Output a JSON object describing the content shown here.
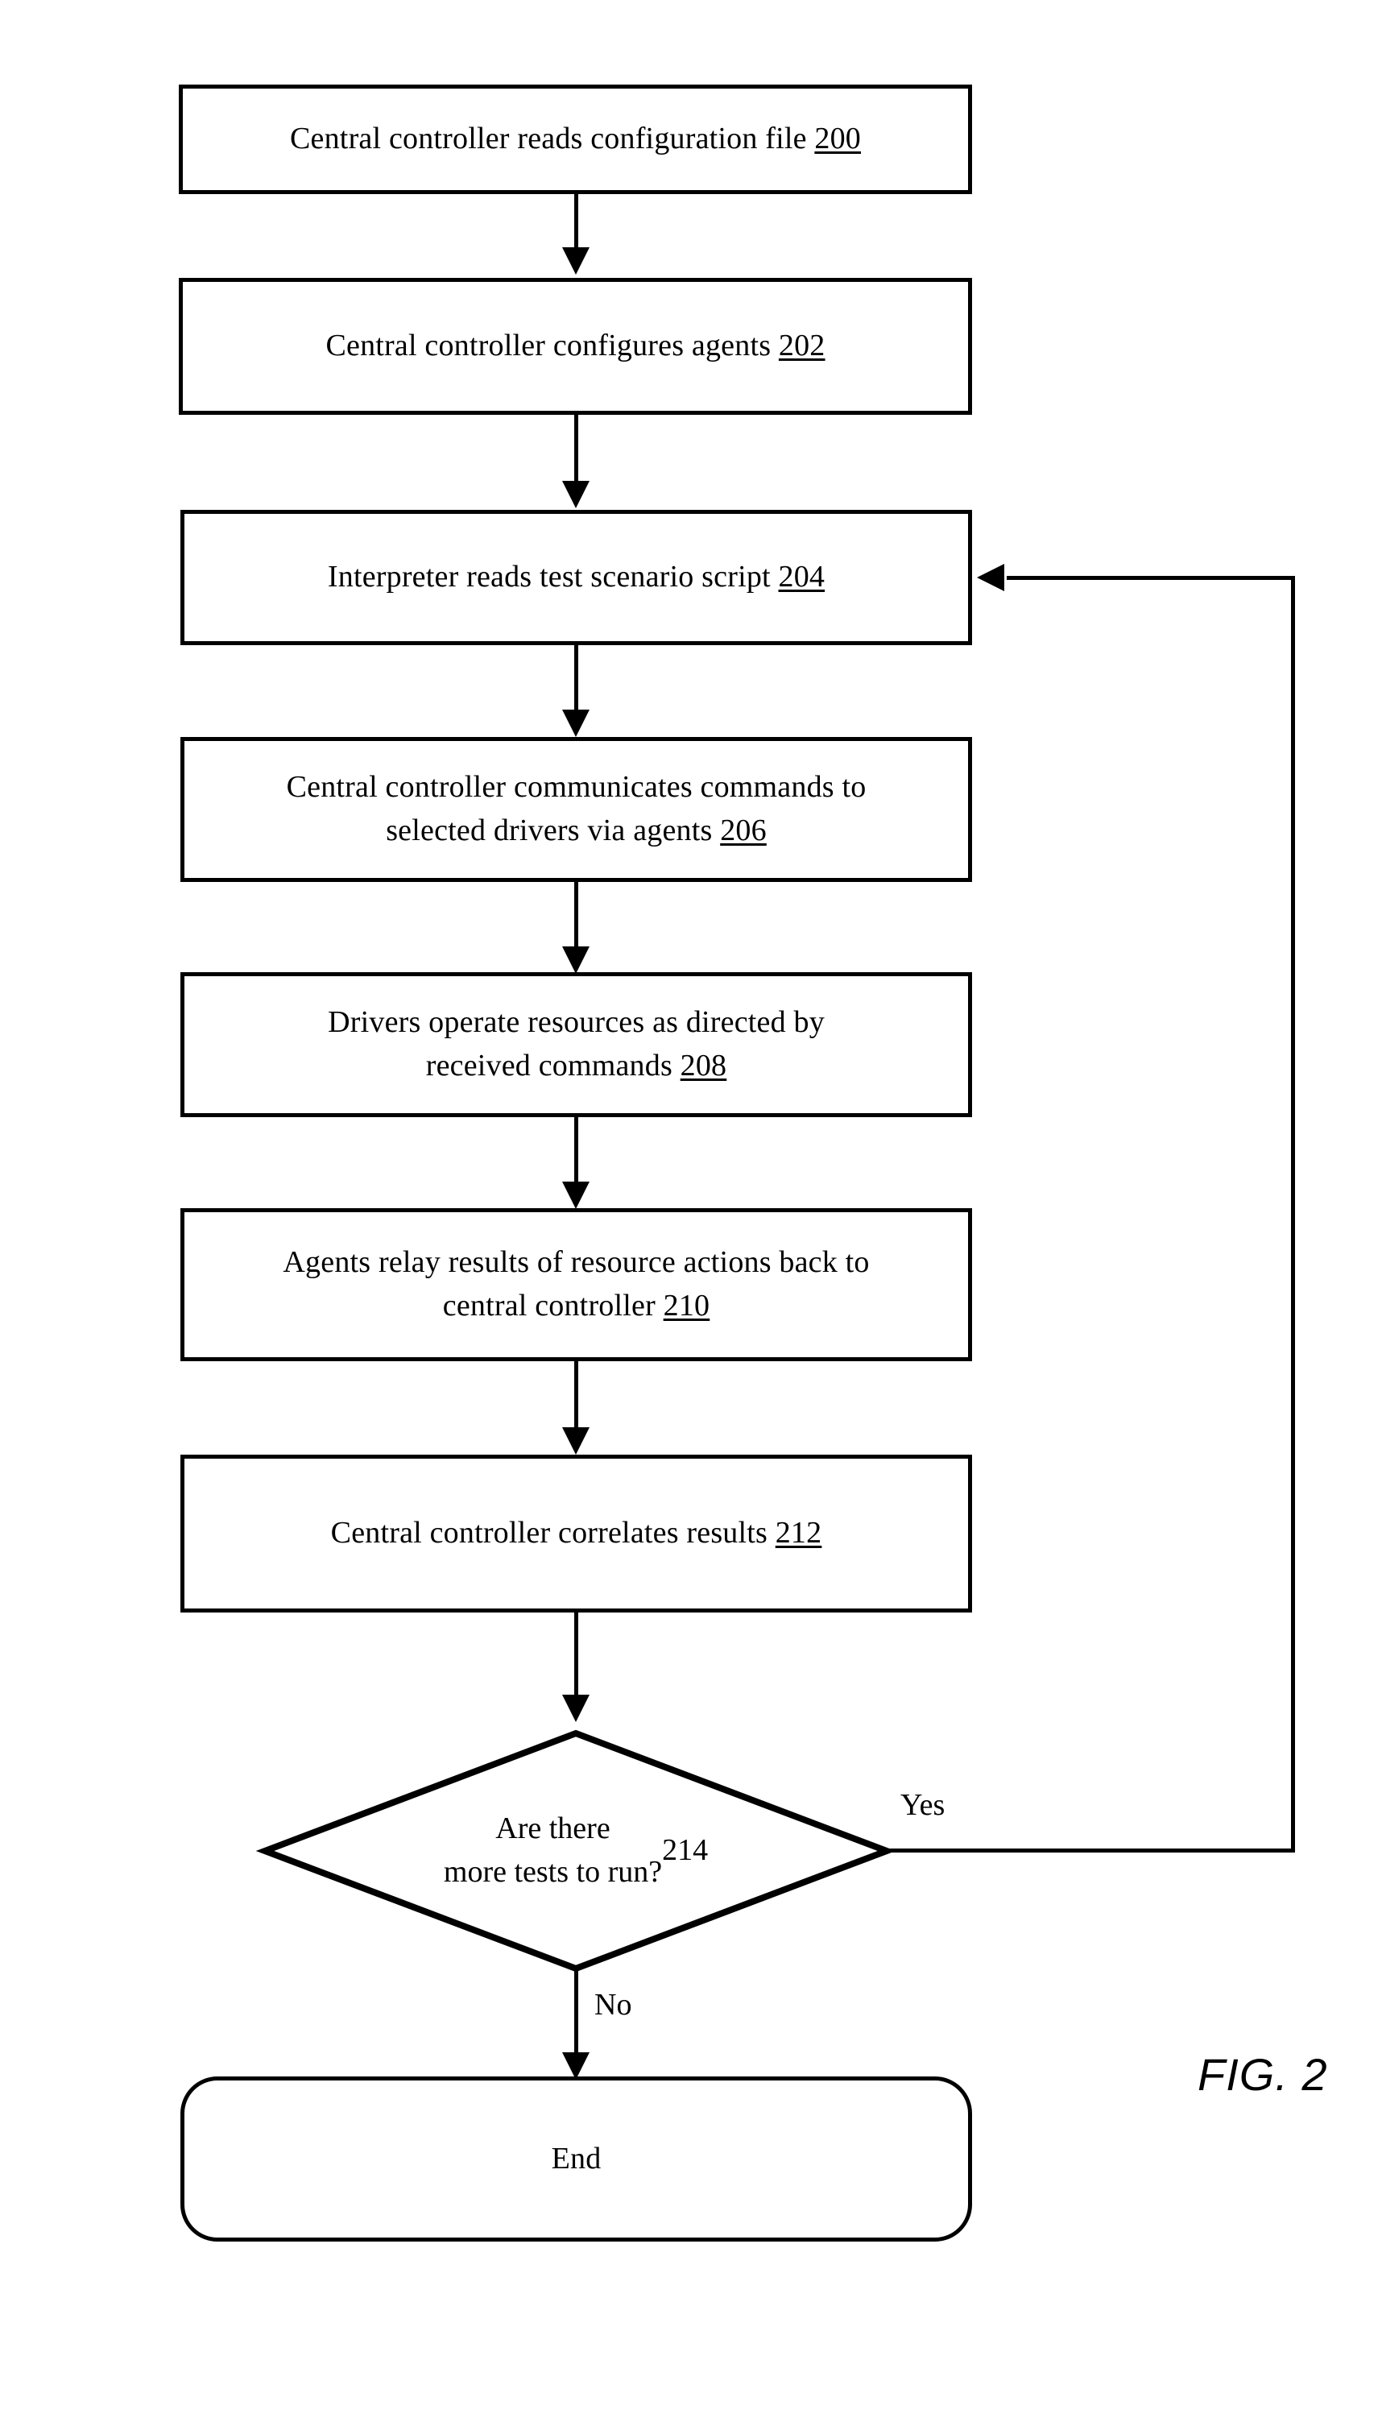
{
  "figure": {
    "caption": "FIG. 2",
    "type": "process-flowchart"
  },
  "chart_data": {
    "type": "flowchart",
    "title": "FIG. 2",
    "orientation": "top-to-bottom",
    "nodes": [
      {
        "id": "200",
        "shape": "rectangle",
        "text": "Central controller reads configuration file",
        "ref": "200"
      },
      {
        "id": "202",
        "shape": "rectangle",
        "text": "Central controller configures agents",
        "ref": "202"
      },
      {
        "id": "204",
        "shape": "rectangle",
        "text": "Interpreter reads test scenario script",
        "ref": "204"
      },
      {
        "id": "206",
        "shape": "rectangle",
        "text": "Central controller communicates commands to\nselected drivers via agents",
        "ref": "206"
      },
      {
        "id": "208",
        "shape": "rectangle",
        "text": "Drivers operate resources as directed by\nreceived commands",
        "ref": "208"
      },
      {
        "id": "210",
        "shape": "rectangle",
        "text": "Agents relay results of resource actions back to\ncentral controller",
        "ref": "210"
      },
      {
        "id": "212",
        "shape": "rectangle",
        "text": "Central controller correlates results",
        "ref": "212"
      },
      {
        "id": "214",
        "shape": "diamond",
        "text": "Are there\nmore tests to run?",
        "ref": "214"
      },
      {
        "id": "end",
        "shape": "terminal",
        "text": "End",
        "ref": ""
      }
    ],
    "edges": [
      {
        "from": "200",
        "to": "202",
        "label": ""
      },
      {
        "from": "202",
        "to": "204",
        "label": ""
      },
      {
        "from": "204",
        "to": "206",
        "label": ""
      },
      {
        "from": "206",
        "to": "208",
        "label": ""
      },
      {
        "from": "208",
        "to": "210",
        "label": ""
      },
      {
        "from": "210",
        "to": "212",
        "label": ""
      },
      {
        "from": "212",
        "to": "214",
        "label": ""
      },
      {
        "from": "214",
        "to": "204",
        "label": "Yes"
      },
      {
        "from": "214",
        "to": "end",
        "label": "No"
      }
    ]
  },
  "nodes": {
    "n200": {
      "text": "Central controller reads configuration file ",
      "ref": "200"
    },
    "n202": {
      "text": "Central controller configures agents ",
      "ref": "202"
    },
    "n204": {
      "text": "Interpreter reads test scenario script ",
      "ref": "204"
    },
    "n206": {
      "text": "Central controller communicates commands to\nselected drivers via agents ",
      "ref": "206"
    },
    "n208": {
      "text": "Drivers operate resources as directed by\nreceived commands ",
      "ref": "208"
    },
    "n210": {
      "text": "Agents relay results of resource actions back to\ncentral controller ",
      "ref": "210"
    },
    "n212": {
      "text": "Central controller correlates results ",
      "ref": "212"
    },
    "n214": {
      "text": "Are there\nmore tests to run?\n",
      "ref": "214"
    },
    "nend": {
      "text": "End",
      "ref": ""
    }
  },
  "labels": {
    "yes": "Yes",
    "no": "No"
  },
  "colors": {
    "ink": "#000000",
    "paper": "#ffffff"
  }
}
